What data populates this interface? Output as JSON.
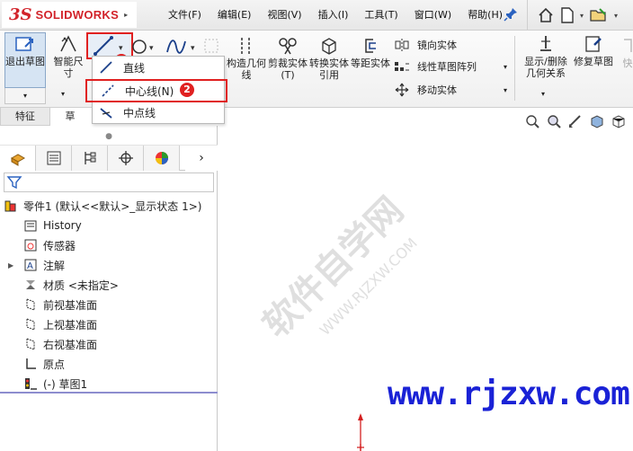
{
  "app": {
    "logo_ds": "3S",
    "logo_name": "SOLIDWORKS"
  },
  "menu": [
    {
      "label": "文件(F)"
    },
    {
      "label": "编辑(E)"
    },
    {
      "label": "视图(V)"
    },
    {
      "label": "插入(I)"
    },
    {
      "label": "工具(T)"
    },
    {
      "label": "窗口(W)"
    },
    {
      "label": "帮助(H)"
    }
  ],
  "toolbar": {
    "exit_sketch": "退出草图",
    "smart_dim": "智能尺寸",
    "construct": "构造几何线",
    "trim": "剪裁实体(T)",
    "convert": "转换实体引用",
    "offset": "等距实体",
    "mirror": "镜向实体",
    "pattern": "线性草图阵列",
    "move": "移动实体",
    "display_delete": "显示/删除几何关系",
    "repair": "修复草图",
    "quick": "快"
  },
  "command_tabs": {
    "feature": "特征",
    "sketch": "草图"
  },
  "dropdown": {
    "line": "直线",
    "centerline": "中心线(N)",
    "midpoint_line": "中点线"
  },
  "badges": {
    "one": "1",
    "two": "2"
  },
  "tree": {
    "part": "零件1  (默认<<默认>_显示状态 1>)",
    "history": "History",
    "sensors": "传感器",
    "annotations": "注解",
    "material": "材质 <未指定>",
    "front_plane": "前视基准面",
    "top_plane": "上视基准面",
    "right_plane": "右视基准面",
    "origin": "原点",
    "sketch": "(-) 草图1"
  },
  "graphics": {
    "watermark": "软件自学网",
    "watermark_url": "WWW.RJZXW.COM",
    "url_text": "www.rjzxw.com"
  },
  "colors": {
    "highlight_red": "#e02020",
    "brand_red": "#d2232a",
    "url_blue": "#1a22d6"
  }
}
